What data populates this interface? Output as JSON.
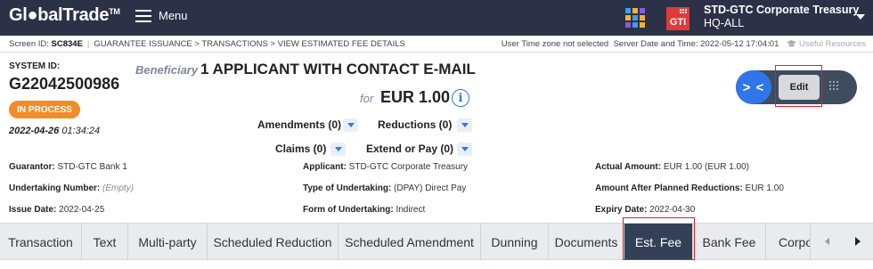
{
  "header": {
    "logo_text": "Gl●balTrade",
    "logo_tm": "TM",
    "menu_label": "Menu",
    "app_badge": "GTI",
    "org_name": "STD-GTC Corporate Treasury",
    "org_unit": "HQ-ALL",
    "colors": {
      "topbar": "#2c3148",
      "apps_grid": [
        "#3aa0e8",
        "#f2b233",
        "#8a5cd6"
      ],
      "badge": "#e23a3a"
    }
  },
  "breadcrumb": {
    "screen_id_label": "Screen ID:",
    "screen_id": "SC834E",
    "path": "GUARANTEE ISSUANCE > TRANSACTIONS > VIEW ESTIMATED FEE DETAILS",
    "timezone_note": "User Time zone not selected",
    "server_time": "Server Date and Time: 2022-05-12 17:04:01",
    "resources": "Useful Resources"
  },
  "record": {
    "system_id_label": "SYSTEM ID:",
    "system_id": "G22042500986",
    "status": "IN PROCESS",
    "status_color": "#f28c28",
    "date": "2022-04-26",
    "time": "01:34:24",
    "beneficiary_label": "Beneficiary",
    "beneficiary_name": "1 APPLICANT WITH CONTACT E-MAIL",
    "for_label": "for",
    "amount": "EUR 1.00"
  },
  "dropdowns": {
    "amendments": "Amendments (0)",
    "reductions": "Reductions (0)",
    "claims": "Claims (0)",
    "extend_or_pay": "Extend or Pay (0)"
  },
  "actions": {
    "toggle_label": "> <",
    "edit_label": "Edit"
  },
  "details": {
    "guarantor_label": "Guarantor:",
    "guarantor_value": "STD-GTC Bank 1",
    "undertaking_number_label": "Undertaking Number:",
    "undertaking_number_value": "(Empty)",
    "issue_date_label": "Issue Date:",
    "issue_date_value": "2022-04-25",
    "applicant_label": "Applicant:",
    "applicant_value": "STD-GTC Corporate Treasury",
    "type_label": "Type of Undertaking:",
    "type_value": "(DPAY) Direct Pay",
    "form_label": "Form of Undertaking:",
    "form_value": "Indirect",
    "actual_amount_label": "Actual Amount:",
    "actual_amount_value": "EUR 1.00 (EUR 1.00)",
    "planned_label": "Amount After Planned Reductions:",
    "planned_value": "EUR 1.00",
    "expiry_label": "Expiry Date:",
    "expiry_value": "2022-04-30"
  },
  "tabs": [
    {
      "label": "Transaction",
      "active": false
    },
    {
      "label": "Text",
      "active": false
    },
    {
      "label": "Multi-party",
      "active": false
    },
    {
      "label": "Scheduled Reduction",
      "active": false
    },
    {
      "label": "Scheduled Amendment",
      "active": false
    },
    {
      "label": "Dunning",
      "active": false
    },
    {
      "label": "Documents",
      "active": false
    },
    {
      "label": "Est. Fee",
      "active": true
    },
    {
      "label": "Bank Fee",
      "active": false
    },
    {
      "label": "Corpo",
      "active": false
    }
  ]
}
